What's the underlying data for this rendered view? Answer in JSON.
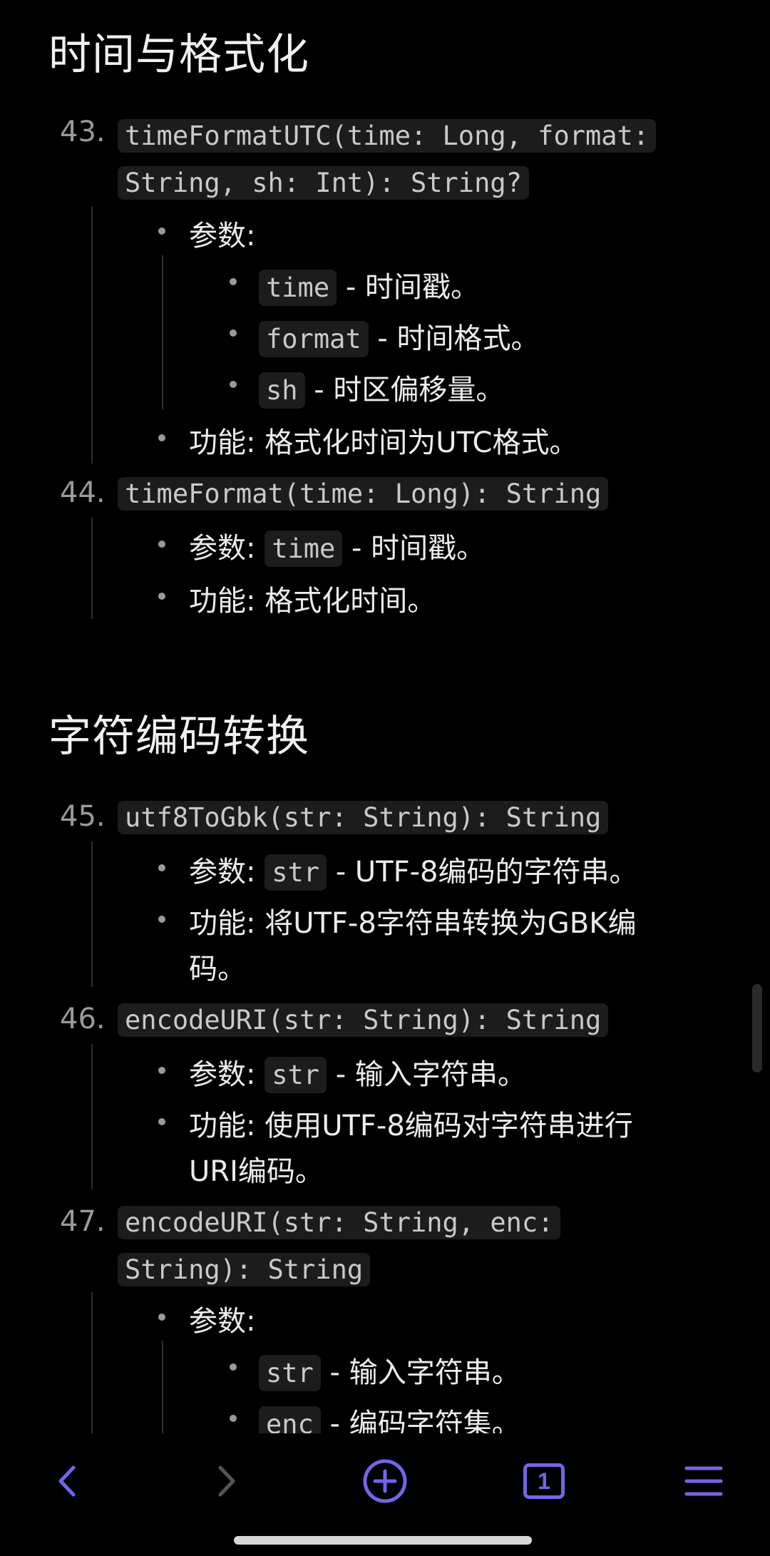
{
  "sections": {
    "time": {
      "title": "时间与格式化"
    },
    "encoding": {
      "title": "字符编码转换"
    }
  },
  "items": {
    "i43": {
      "number": "43.",
      "sig_line1": "timeFormatUTC(time: Long, format:",
      "sig_line2": "String, sh: Int): String?",
      "params_label": "参数:",
      "params": [
        {
          "name": "time",
          "desc": "- 时间戳。"
        },
        {
          "name": "format",
          "desc": "- 时间格式。"
        },
        {
          "name": "sh",
          "desc": "- 时区偏移量。"
        }
      ],
      "func": "功能: 格式化时间为UTC格式。"
    },
    "i44": {
      "number": "44.",
      "sig_line1": "timeFormat(time: Long): String",
      "params_label": "参数:",
      "param_name": "time",
      "param_desc": "- 时间戳。",
      "func": "功能: 格式化时间。"
    },
    "i45": {
      "number": "45.",
      "sig_line1": "utf8ToGbk(str: String): String",
      "params_label": "参数:",
      "param_name": "str",
      "param_desc": "- UTF-8编码的字符串。",
      "func_line1": "功能: 将UTF-8字符串转换为GBK编",
      "func_line2": "码。"
    },
    "i46": {
      "number": "46.",
      "sig_line1": "encodeURI(str: String): String",
      "params_label": "参数:",
      "param_name": "str",
      "param_desc": "- 输入字符串。",
      "func_line1": "功能: 使用UTF-8编码对字符串进行",
      "func_line2": "URI编码。"
    },
    "i47": {
      "number": "47.",
      "sig_line1": "encodeURI(str: String, enc:",
      "sig_line2": "String): String",
      "params_label": "参数:",
      "params": [
        {
          "name": "str",
          "desc": "- 输入字符串。"
        },
        {
          "name": "enc",
          "desc": "- 编码字符集。"
        }
      ]
    }
  },
  "toolbar": {
    "back_icon": "chevron-left-icon",
    "forward_icon": "chevron-right-icon",
    "new_tab_icon": "plus-circle-icon",
    "tab_count": "1",
    "menu_icon": "hamburger-menu-icon",
    "accent_color": "#7b61e8",
    "disabled_color": "#555555"
  }
}
